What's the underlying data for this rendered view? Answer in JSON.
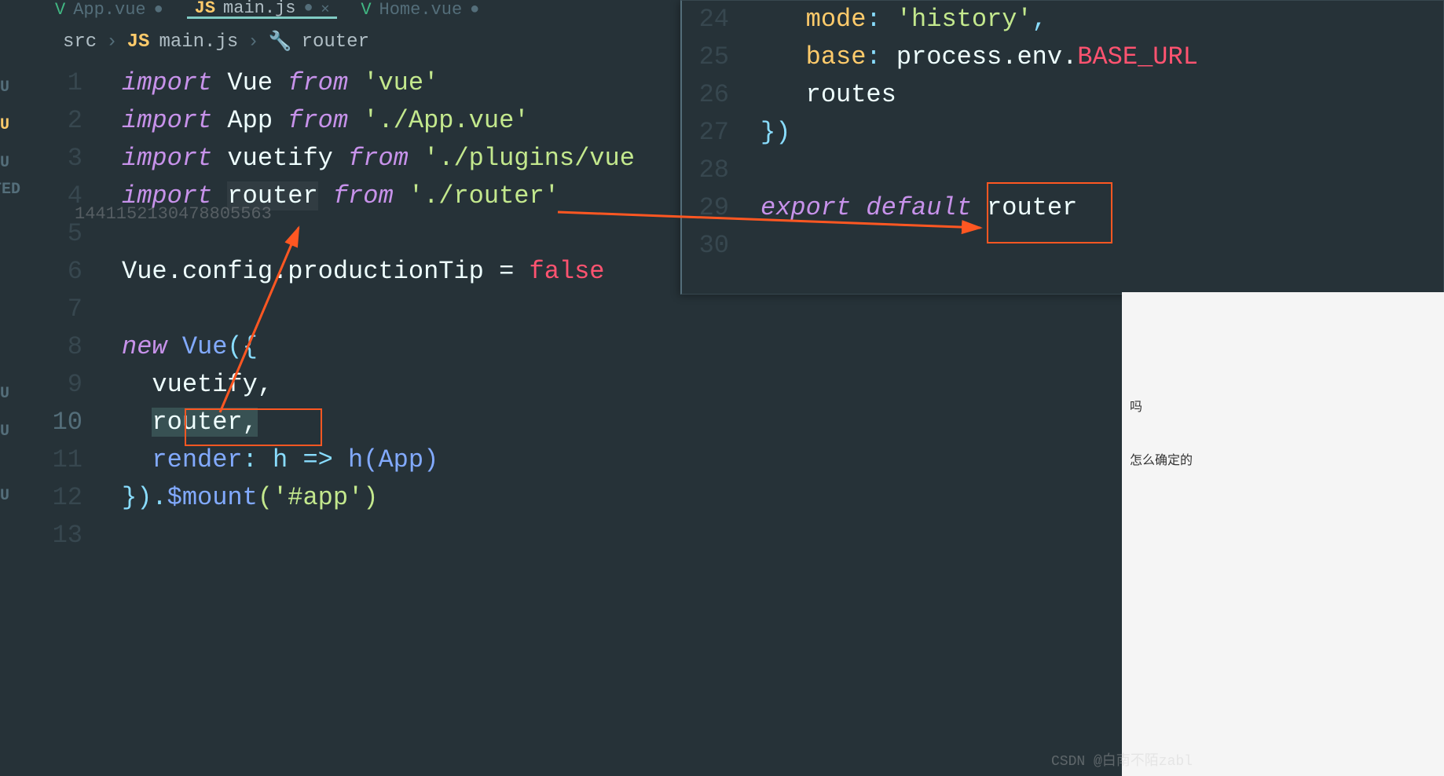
{
  "tabs": [
    {
      "icon": "V",
      "name": "App.vue",
      "dirty": "●"
    },
    {
      "icon": "JS",
      "name": "main.js",
      "dirty": "●"
    },
    {
      "icon": "V",
      "name": "Home.vue",
      "dirty": "●"
    }
  ],
  "breadcrumb": {
    "src": "src",
    "file": "main.js",
    "symbol": "router"
  },
  "leftMarks": [
    "U",
    "U",
    "U",
    "TED",
    "U",
    "U",
    "U"
  ],
  "code": {
    "l1": {
      "n": "1",
      "kw1": "import",
      "id": "Vue",
      "kw2": "from",
      "str": "'vue'"
    },
    "l2": {
      "n": "2",
      "kw1": "import",
      "id": "App",
      "kw2": "from",
      "str": "'./App.vue'"
    },
    "l3": {
      "n": "3",
      "kw1": "import",
      "id": "vuetify",
      "kw2": "from",
      "str": "'./plugins/vue"
    },
    "l4": {
      "n": "4",
      "kw1": "import",
      "id": "router",
      "kw2": "from",
      "str": "'./router'"
    },
    "l5": {
      "n": "5"
    },
    "l6": {
      "n": "6",
      "t": "Vue.config.productionTip = "
    },
    "l6b": "false",
    "l7": {
      "n": "7"
    },
    "l8": {
      "n": "8",
      "kw": "new",
      "cls": "Vue",
      "open": "({"
    },
    "l9": {
      "n": "9",
      "t": "vuetify,"
    },
    "l10": {
      "n": "10",
      "t": "router,"
    },
    "l11": {
      "n": "11",
      "prop": "render",
      "arrow": ": h => ",
      "call": "h(App)"
    },
    "l12": {
      "n": "12",
      "close": "}).",
      "fn": "$mount",
      "arg": "('#app')"
    },
    "l13": {
      "n": "13"
    }
  },
  "popup": {
    "l24": {
      "n": "24",
      "prop": "mode",
      "val": "'history'"
    },
    "l25": {
      "n": "25",
      "prop": "base",
      "obj": "process.env.",
      "red": "BASE_URL"
    },
    "l26": {
      "n": "26",
      "t": "routes"
    },
    "l27": {
      "n": "27",
      "t": "})"
    },
    "l28": {
      "n": "28"
    },
    "l29": {
      "n": "29",
      "kw": "export default",
      "id": "router"
    },
    "l30": {
      "n": "30"
    }
  },
  "watermark": "1441152130478805563",
  "rightPanel": {
    "q1": "吗",
    "q2": "怎么确定的"
  },
  "credit": "CSDN @白南不陌zabl"
}
